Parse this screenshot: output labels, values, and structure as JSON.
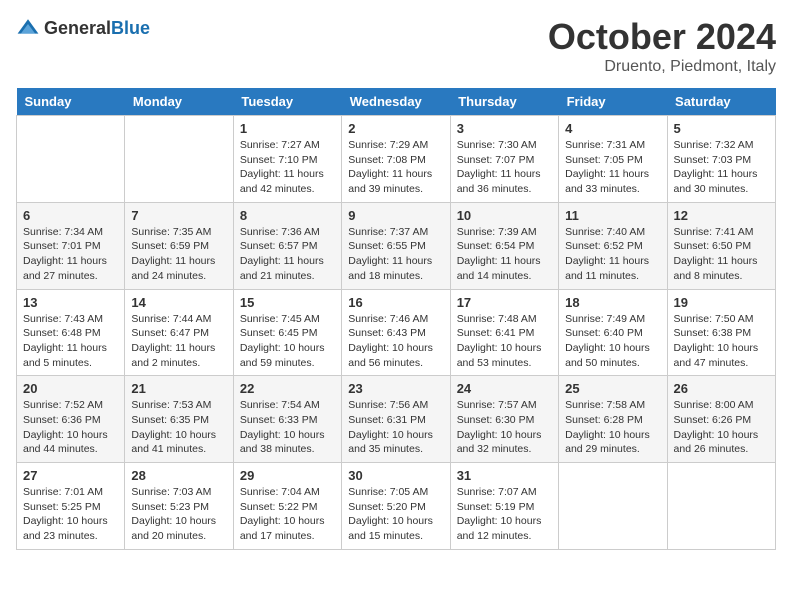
{
  "header": {
    "logo_general": "General",
    "logo_blue": "Blue",
    "title": "October 2024",
    "location": "Druento, Piedmont, Italy"
  },
  "calendar": {
    "days_of_week": [
      "Sunday",
      "Monday",
      "Tuesday",
      "Wednesday",
      "Thursday",
      "Friday",
      "Saturday"
    ],
    "weeks": [
      [
        {
          "day": "",
          "sunrise": "",
          "sunset": "",
          "daylight": ""
        },
        {
          "day": "",
          "sunrise": "",
          "sunset": "",
          "daylight": ""
        },
        {
          "day": "1",
          "sunrise": "Sunrise: 7:27 AM",
          "sunset": "Sunset: 7:10 PM",
          "daylight": "Daylight: 11 hours and 42 minutes."
        },
        {
          "day": "2",
          "sunrise": "Sunrise: 7:29 AM",
          "sunset": "Sunset: 7:08 PM",
          "daylight": "Daylight: 11 hours and 39 minutes."
        },
        {
          "day": "3",
          "sunrise": "Sunrise: 7:30 AM",
          "sunset": "Sunset: 7:07 PM",
          "daylight": "Daylight: 11 hours and 36 minutes."
        },
        {
          "day": "4",
          "sunrise": "Sunrise: 7:31 AM",
          "sunset": "Sunset: 7:05 PM",
          "daylight": "Daylight: 11 hours and 33 minutes."
        },
        {
          "day": "5",
          "sunrise": "Sunrise: 7:32 AM",
          "sunset": "Sunset: 7:03 PM",
          "daylight": "Daylight: 11 hours and 30 minutes."
        }
      ],
      [
        {
          "day": "6",
          "sunrise": "Sunrise: 7:34 AM",
          "sunset": "Sunset: 7:01 PM",
          "daylight": "Daylight: 11 hours and 27 minutes."
        },
        {
          "day": "7",
          "sunrise": "Sunrise: 7:35 AM",
          "sunset": "Sunset: 6:59 PM",
          "daylight": "Daylight: 11 hours and 24 minutes."
        },
        {
          "day": "8",
          "sunrise": "Sunrise: 7:36 AM",
          "sunset": "Sunset: 6:57 PM",
          "daylight": "Daylight: 11 hours and 21 minutes."
        },
        {
          "day": "9",
          "sunrise": "Sunrise: 7:37 AM",
          "sunset": "Sunset: 6:55 PM",
          "daylight": "Daylight: 11 hours and 18 minutes."
        },
        {
          "day": "10",
          "sunrise": "Sunrise: 7:39 AM",
          "sunset": "Sunset: 6:54 PM",
          "daylight": "Daylight: 11 hours and 14 minutes."
        },
        {
          "day": "11",
          "sunrise": "Sunrise: 7:40 AM",
          "sunset": "Sunset: 6:52 PM",
          "daylight": "Daylight: 11 hours and 11 minutes."
        },
        {
          "day": "12",
          "sunrise": "Sunrise: 7:41 AM",
          "sunset": "Sunset: 6:50 PM",
          "daylight": "Daylight: 11 hours and 8 minutes."
        }
      ],
      [
        {
          "day": "13",
          "sunrise": "Sunrise: 7:43 AM",
          "sunset": "Sunset: 6:48 PM",
          "daylight": "Daylight: 11 hours and 5 minutes."
        },
        {
          "day": "14",
          "sunrise": "Sunrise: 7:44 AM",
          "sunset": "Sunset: 6:47 PM",
          "daylight": "Daylight: 11 hours and 2 minutes."
        },
        {
          "day": "15",
          "sunrise": "Sunrise: 7:45 AM",
          "sunset": "Sunset: 6:45 PM",
          "daylight": "Daylight: 10 hours and 59 minutes."
        },
        {
          "day": "16",
          "sunrise": "Sunrise: 7:46 AM",
          "sunset": "Sunset: 6:43 PM",
          "daylight": "Daylight: 10 hours and 56 minutes."
        },
        {
          "day": "17",
          "sunrise": "Sunrise: 7:48 AM",
          "sunset": "Sunset: 6:41 PM",
          "daylight": "Daylight: 10 hours and 53 minutes."
        },
        {
          "day": "18",
          "sunrise": "Sunrise: 7:49 AM",
          "sunset": "Sunset: 6:40 PM",
          "daylight": "Daylight: 10 hours and 50 minutes."
        },
        {
          "day": "19",
          "sunrise": "Sunrise: 7:50 AM",
          "sunset": "Sunset: 6:38 PM",
          "daylight": "Daylight: 10 hours and 47 minutes."
        }
      ],
      [
        {
          "day": "20",
          "sunrise": "Sunrise: 7:52 AM",
          "sunset": "Sunset: 6:36 PM",
          "daylight": "Daylight: 10 hours and 44 minutes."
        },
        {
          "day": "21",
          "sunrise": "Sunrise: 7:53 AM",
          "sunset": "Sunset: 6:35 PM",
          "daylight": "Daylight: 10 hours and 41 minutes."
        },
        {
          "day": "22",
          "sunrise": "Sunrise: 7:54 AM",
          "sunset": "Sunset: 6:33 PM",
          "daylight": "Daylight: 10 hours and 38 minutes."
        },
        {
          "day": "23",
          "sunrise": "Sunrise: 7:56 AM",
          "sunset": "Sunset: 6:31 PM",
          "daylight": "Daylight: 10 hours and 35 minutes."
        },
        {
          "day": "24",
          "sunrise": "Sunrise: 7:57 AM",
          "sunset": "Sunset: 6:30 PM",
          "daylight": "Daylight: 10 hours and 32 minutes."
        },
        {
          "day": "25",
          "sunrise": "Sunrise: 7:58 AM",
          "sunset": "Sunset: 6:28 PM",
          "daylight": "Daylight: 10 hours and 29 minutes."
        },
        {
          "day": "26",
          "sunrise": "Sunrise: 8:00 AM",
          "sunset": "Sunset: 6:26 PM",
          "daylight": "Daylight: 10 hours and 26 minutes."
        }
      ],
      [
        {
          "day": "27",
          "sunrise": "Sunrise: 7:01 AM",
          "sunset": "Sunset: 5:25 PM",
          "daylight": "Daylight: 10 hours and 23 minutes."
        },
        {
          "day": "28",
          "sunrise": "Sunrise: 7:03 AM",
          "sunset": "Sunset: 5:23 PM",
          "daylight": "Daylight: 10 hours and 20 minutes."
        },
        {
          "day": "29",
          "sunrise": "Sunrise: 7:04 AM",
          "sunset": "Sunset: 5:22 PM",
          "daylight": "Daylight: 10 hours and 17 minutes."
        },
        {
          "day": "30",
          "sunrise": "Sunrise: 7:05 AM",
          "sunset": "Sunset: 5:20 PM",
          "daylight": "Daylight: 10 hours and 15 minutes."
        },
        {
          "day": "31",
          "sunrise": "Sunrise: 7:07 AM",
          "sunset": "Sunset: 5:19 PM",
          "daylight": "Daylight: 10 hours and 12 minutes."
        },
        {
          "day": "",
          "sunrise": "",
          "sunset": "",
          "daylight": ""
        },
        {
          "day": "",
          "sunrise": "",
          "sunset": "",
          "daylight": ""
        }
      ]
    ]
  }
}
